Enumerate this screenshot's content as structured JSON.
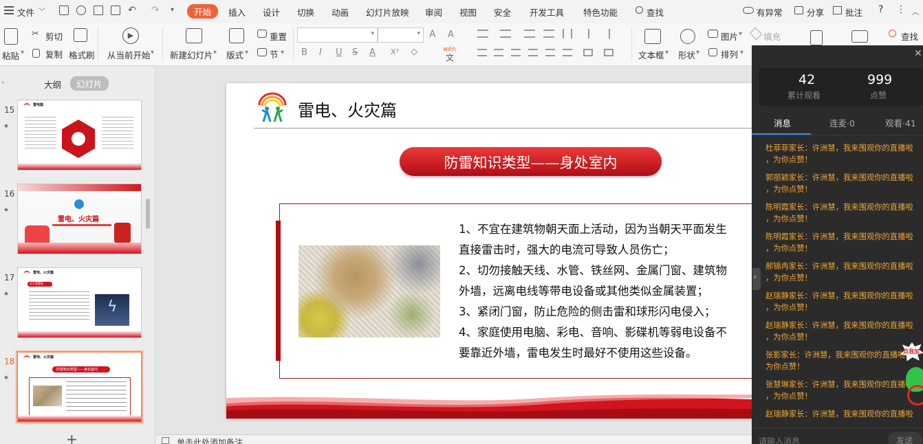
{
  "menubar": {
    "file": "文件",
    "tabs": [
      "开始",
      "插入",
      "设计",
      "切换",
      "动画",
      "幻灯片放映",
      "审阅",
      "视图",
      "安全",
      "开发工具",
      "特色功能"
    ],
    "search": "查找",
    "right": {
      "anomaly": "有异常",
      "share": "分享",
      "comment": "批注",
      "help": "?"
    }
  },
  "ribbon": {
    "paste": "粘贴",
    "cut": "剪切",
    "copy": "复制",
    "format_painter": "格式刷",
    "play_from_current": "从当前开始",
    "new_slide": "新建幻灯片",
    "layout": "版式",
    "reset": "重置",
    "section": "节",
    "bold": "B",
    "italic": "I",
    "underline": "U",
    "strike": "S",
    "fontcolor": "A",
    "superscript": "X²",
    "clear": "◇",
    "pinyin": "wén",
    "textbox": "文本框",
    "shape": "形状",
    "picture": "图片",
    "fill": "填充",
    "arrange": "排列",
    "search": "查找"
  },
  "leftpanel": {
    "tab_outline": "大纲",
    "tab_slides": "幻灯片",
    "slides": [
      {
        "num": "15",
        "title": "雷电篇"
      },
      {
        "num": "16",
        "title": "雷电、火灾篇"
      },
      {
        "num": "17",
        "title": "雷电、火灾篇",
        "subtitle": "什么是雷电"
      },
      {
        "num": "18",
        "title": "雷电、火灾篇",
        "banner": "防雷知识类型——身处室内"
      }
    ],
    "add": "+"
  },
  "slide": {
    "title": "雷电、火灾篇",
    "banner": "防雷知识类型——身处室内",
    "lines": [
      "1、不宜在建筑物朝天面上活动，因为当朝天平面发生",
      "直接雷击时，强大的电流可导致人员伤亡；",
      "2、切勿接触天线、水管、铁丝网、金属门窗、建筑物",
      "外墙，远离电线等带电设备或其他类似金属装置；",
      "3、紧闭门窗，防止危险的侧击雷和球形闪电侵入；",
      "4、家庭使用电脑、彩电、音响、影碟机等弱电设备不",
      "要靠近外墙，雷电发生时最好不使用这些设备。"
    ]
  },
  "notes": {
    "placeholder": "单击此处添加备注"
  },
  "live": {
    "views": "42",
    "views_label": "累计观看",
    "likes": "999",
    "likes_label": "点赞",
    "tabs": [
      "消息",
      "连麦·0",
      "观看·41"
    ],
    "messages": [
      {
        "l1": "杜菲菲家长：许洲慧，我来围观你的直播啦",
        "l2": "，为你点赞！"
      },
      {
        "l1": "郭丽颖家长：许洲慧，我来围观你的直播啦",
        "l2": "，为你点赞！"
      },
      {
        "l1": "陈明霞家长：许洲慧，我来围观你的直播啦",
        "l2": "，为你点赞！"
      },
      {
        "l1": "陈明霞家长：许洲慧，我来围观你的直播啦",
        "l2": "，为你点赞！"
      },
      {
        "l1": "郝锦冉家长：许洲慧，我来围观你的直播啦",
        "l2": "，为你点赞！"
      },
      {
        "l1": "赵瑞静家长：许洲慧，我来围观你的直播啦",
        "l2": "，为你点赞！"
      },
      {
        "l1": "赵瑞静家长：许洲慧，我来围观你的直播啦",
        "l2": "，为你点赞！"
      },
      {
        "l1": "张影家长：许洲慧，我来围观你的直播啦，",
        "l2": "为你点赞！"
      },
      {
        "l1": "张慧琳家长：许洲慧，我来围观你的直播啦",
        "l2": "，为你点赞！"
      },
      {
        "l1": "赵瑞静家长：许洲慧，我来围观你的直播啦",
        "l2": ""
      }
    ],
    "input_placeholder": "请输入消息",
    "send": "发送",
    "badge": "点我加"
  }
}
